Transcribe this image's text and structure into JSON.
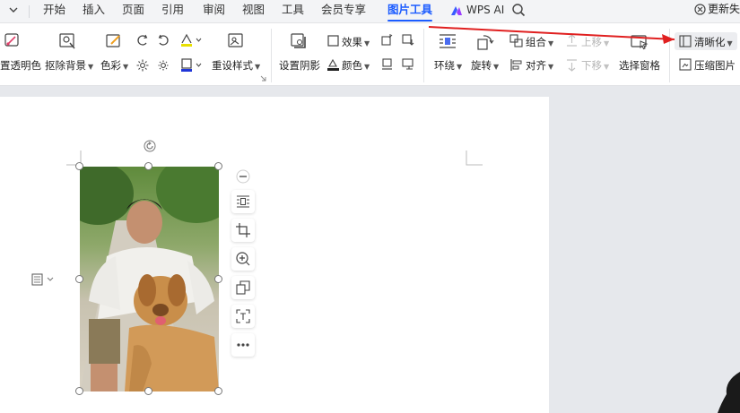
{
  "menubar": {
    "tabs": [
      {
        "label": "开始",
        "active": false
      },
      {
        "label": "插入",
        "active": false
      },
      {
        "label": "页面",
        "active": false
      },
      {
        "label": "引用",
        "active": false
      },
      {
        "label": "审阅",
        "active": false
      },
      {
        "label": "视图",
        "active": false
      },
      {
        "label": "工具",
        "active": false
      },
      {
        "label": "会员专享",
        "active": false
      },
      {
        "label": "图片工具",
        "active": true
      }
    ],
    "wps_ai_label": "WPS AI",
    "update_label": "更新失"
  },
  "ribbon": {
    "set_transparent": "置透明色",
    "remove_background": "抠除背景",
    "color": "色彩",
    "reset_style": "重设样式",
    "set_shadow": "设置阴影",
    "effects": "效果",
    "fill_color": "颜色",
    "wrap": "环绕",
    "rotate": "旋转",
    "group": "组合",
    "align": "对齐",
    "bring_forward": "上移",
    "send_backward": "下移",
    "selection_pane": "选择窗格",
    "sharpen": "清晰化",
    "compress": "压缩图片"
  },
  "colors": {
    "accent_blue": "#1c5cff",
    "arrow_red": "#e02020"
  }
}
